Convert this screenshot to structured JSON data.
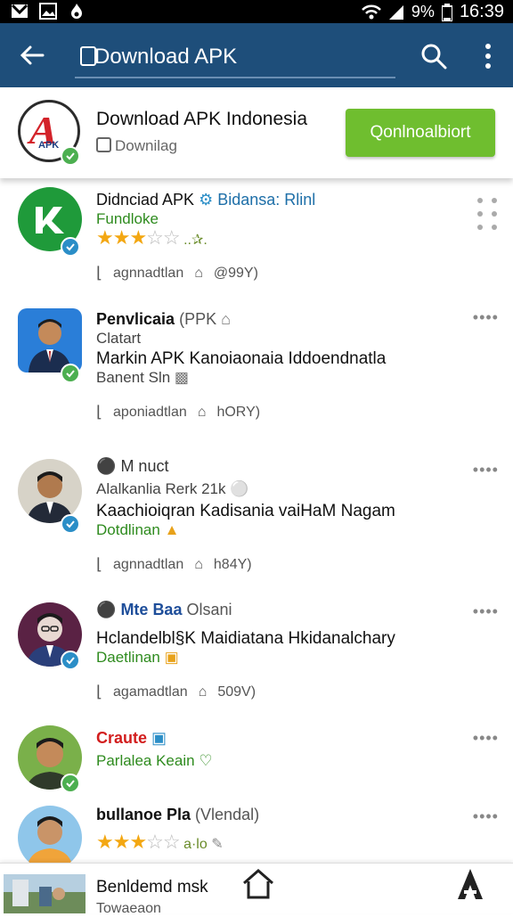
{
  "status_bar": {
    "battery": "9%",
    "time": "16:39"
  },
  "app_bar": {
    "search_text": "Download APK"
  },
  "header": {
    "title": "Download APK Indonesia",
    "subtitle": "Downilag",
    "button_label": "Qonlnoalbiort",
    "logo_text": "APK"
  },
  "items": [
    {
      "title": "Didnciad APK",
      "tag": "Bidansa: Rlinl",
      "line2": "Fundloke",
      "rating_text": "..✰.",
      "stat_label": "agnnadtlan",
      "stat_value": "@99Y)"
    },
    {
      "title": "Penvlicaia",
      "tag": "(PPK",
      "line2": "Clatart",
      "line3": "Markin APK Kanoiaonaia Iddoendnatla",
      "line4": "Banent Sln",
      "stat_label": "aponiadtlan",
      "stat_value": "hORY)"
    },
    {
      "title": "M nuct",
      "line2": "Alalkanlia Rerk 21k",
      "line3": "Kaachioiqran Kadisania vaiHaM Nagam",
      "line4": "Dotdlinan",
      "stat_label": "agnnadtlan",
      "stat_value": "h84Y)"
    },
    {
      "title": "Mte Baa",
      "tag": "Olsani",
      "line3": "Hclandelbl§K Maidiatana Hkidanalchary",
      "line4": "Daetlinan",
      "stat_label": "agamadtlan",
      "stat_value": "509V)"
    },
    {
      "title": "Craute",
      "line2": "Parlalea Keain"
    },
    {
      "title": "bullanoe Pla",
      "tag": "(Vlendal)",
      "rating_text": "a·lo"
    }
  ],
  "bottom_bar": {
    "line1": "Benldemd msk",
    "line2": "Towaeaon"
  },
  "colors": {
    "app_bar": "#1e4e7a",
    "download_button": "#6fbe2f",
    "link_blue": "#1e6fa8",
    "green_text": "#2e8b1e",
    "red_text": "#d21e1e",
    "star": "#f3a712"
  }
}
